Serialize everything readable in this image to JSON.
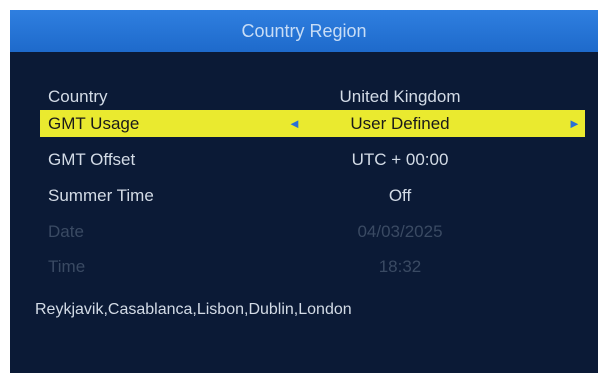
{
  "title": "Country Region",
  "rows": [
    {
      "label": "Country",
      "value": "United Kingdom"
    },
    {
      "label": "GMT Usage",
      "value": "User Defined",
      "left_arrow": "◄",
      "right_arrow": "►"
    },
    {
      "label": "GMT Offset",
      "value": "UTC + 00:00"
    },
    {
      "label": "Summer Time",
      "value": "Off"
    },
    {
      "label": "Date",
      "value": "04/03/2025"
    },
    {
      "label": "Time",
      "value": "18:32"
    }
  ],
  "description": "Reykjavik,Casablanca,Lisbon,Dublin,London",
  "colors": {
    "background": "#0b1a36",
    "title_bar": "#2f7fe0",
    "highlight": "#eaea2f",
    "arrow": "#2a6fd6",
    "text": "#d3dbe6",
    "disabled_text": "#3a4a63"
  }
}
